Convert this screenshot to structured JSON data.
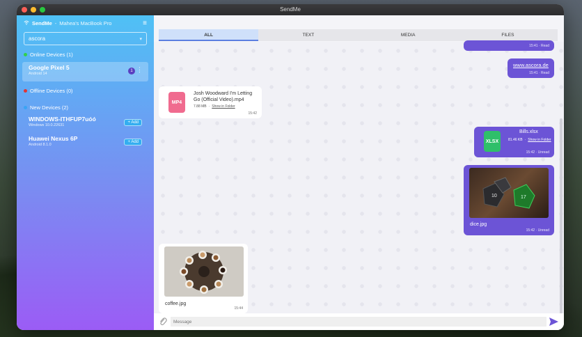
{
  "window": {
    "title": "SendMe"
  },
  "sidebar": {
    "app_name": "SendMe",
    "separator": "-",
    "device_name": "Mahea's MacBook Pro",
    "search_value": "ascora",
    "sections": {
      "online": "Online Devices (1)",
      "offline": "Offline Devices (0)",
      "new": "New Devices (2)"
    },
    "online_devices": [
      {
        "name": "Google Pixel 5",
        "os": "Android 14",
        "badge": "1"
      }
    ],
    "new_devices": [
      {
        "name": "WINDOWS-ITHFUP7uóó",
        "os": "Windows 10.0.22631",
        "button": "+ Add"
      },
      {
        "name": "Huawei Nexus 6P",
        "os": "Android 8.1.0",
        "button": "+ Add"
      }
    ],
    "colors": {
      "online": "#32d04a",
      "offline": "#e03535",
      "new": "#3aa4f5"
    }
  },
  "tabs": [
    "ALL",
    "TEXT",
    "MEDIA",
    "FILES"
  ],
  "messages": {
    "m0": {
      "meta": "15:41 · Read"
    },
    "m1": {
      "text": "www.ascora.de",
      "meta": "15:41 · Read"
    },
    "m2": {
      "file": "Josh Woodward I'm Letting Go (Official Video).mp4",
      "size": "7.88 MB",
      "dot": "·",
      "action": "Show in Folder",
      "icon": "MP4",
      "time": "15:42"
    },
    "m3": {
      "file": "Bills.xlsx",
      "size": "81.46 KB",
      "dot": "·",
      "action": "Show in Folder",
      "icon": "XLSX",
      "meta": "15:42 · Unread"
    },
    "m4": {
      "file": "dice.jpg",
      "meta": "15:42 · Unread"
    },
    "m5": {
      "file": "coffee.jpg",
      "time": "15:44"
    }
  },
  "composer": {
    "placeholder": "Message"
  }
}
